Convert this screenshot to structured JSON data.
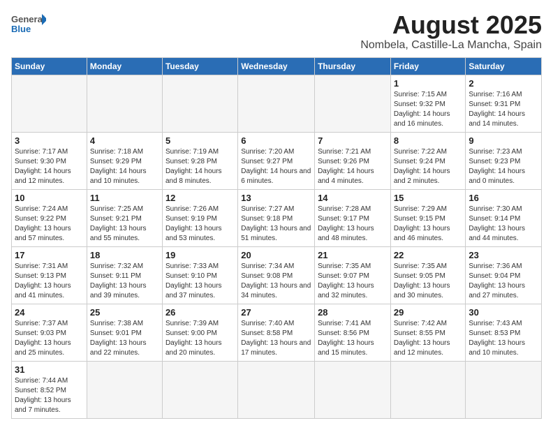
{
  "header": {
    "logo_general": "General",
    "logo_blue": "Blue",
    "month": "August 2025",
    "location": "Nombela, Castille-La Mancha, Spain"
  },
  "weekdays": [
    "Sunday",
    "Monday",
    "Tuesday",
    "Wednesday",
    "Thursday",
    "Friday",
    "Saturday"
  ],
  "weeks": [
    [
      {
        "day": "",
        "info": ""
      },
      {
        "day": "",
        "info": ""
      },
      {
        "day": "",
        "info": ""
      },
      {
        "day": "",
        "info": ""
      },
      {
        "day": "",
        "info": ""
      },
      {
        "day": "1",
        "info": "Sunrise: 7:15 AM\nSunset: 9:32 PM\nDaylight: 14 hours and 16 minutes."
      },
      {
        "day": "2",
        "info": "Sunrise: 7:16 AM\nSunset: 9:31 PM\nDaylight: 14 hours and 14 minutes."
      }
    ],
    [
      {
        "day": "3",
        "info": "Sunrise: 7:17 AM\nSunset: 9:30 PM\nDaylight: 14 hours and 12 minutes."
      },
      {
        "day": "4",
        "info": "Sunrise: 7:18 AM\nSunset: 9:29 PM\nDaylight: 14 hours and 10 minutes."
      },
      {
        "day": "5",
        "info": "Sunrise: 7:19 AM\nSunset: 9:28 PM\nDaylight: 14 hours and 8 minutes."
      },
      {
        "day": "6",
        "info": "Sunrise: 7:20 AM\nSunset: 9:27 PM\nDaylight: 14 hours and 6 minutes."
      },
      {
        "day": "7",
        "info": "Sunrise: 7:21 AM\nSunset: 9:26 PM\nDaylight: 14 hours and 4 minutes."
      },
      {
        "day": "8",
        "info": "Sunrise: 7:22 AM\nSunset: 9:24 PM\nDaylight: 14 hours and 2 minutes."
      },
      {
        "day": "9",
        "info": "Sunrise: 7:23 AM\nSunset: 9:23 PM\nDaylight: 14 hours and 0 minutes."
      }
    ],
    [
      {
        "day": "10",
        "info": "Sunrise: 7:24 AM\nSunset: 9:22 PM\nDaylight: 13 hours and 57 minutes."
      },
      {
        "day": "11",
        "info": "Sunrise: 7:25 AM\nSunset: 9:21 PM\nDaylight: 13 hours and 55 minutes."
      },
      {
        "day": "12",
        "info": "Sunrise: 7:26 AM\nSunset: 9:19 PM\nDaylight: 13 hours and 53 minutes."
      },
      {
        "day": "13",
        "info": "Sunrise: 7:27 AM\nSunset: 9:18 PM\nDaylight: 13 hours and 51 minutes."
      },
      {
        "day": "14",
        "info": "Sunrise: 7:28 AM\nSunset: 9:17 PM\nDaylight: 13 hours and 48 minutes."
      },
      {
        "day": "15",
        "info": "Sunrise: 7:29 AM\nSunset: 9:15 PM\nDaylight: 13 hours and 46 minutes."
      },
      {
        "day": "16",
        "info": "Sunrise: 7:30 AM\nSunset: 9:14 PM\nDaylight: 13 hours and 44 minutes."
      }
    ],
    [
      {
        "day": "17",
        "info": "Sunrise: 7:31 AM\nSunset: 9:13 PM\nDaylight: 13 hours and 41 minutes."
      },
      {
        "day": "18",
        "info": "Sunrise: 7:32 AM\nSunset: 9:11 PM\nDaylight: 13 hours and 39 minutes."
      },
      {
        "day": "19",
        "info": "Sunrise: 7:33 AM\nSunset: 9:10 PM\nDaylight: 13 hours and 37 minutes."
      },
      {
        "day": "20",
        "info": "Sunrise: 7:34 AM\nSunset: 9:08 PM\nDaylight: 13 hours and 34 minutes."
      },
      {
        "day": "21",
        "info": "Sunrise: 7:35 AM\nSunset: 9:07 PM\nDaylight: 13 hours and 32 minutes."
      },
      {
        "day": "22",
        "info": "Sunrise: 7:35 AM\nSunset: 9:05 PM\nDaylight: 13 hours and 30 minutes."
      },
      {
        "day": "23",
        "info": "Sunrise: 7:36 AM\nSunset: 9:04 PM\nDaylight: 13 hours and 27 minutes."
      }
    ],
    [
      {
        "day": "24",
        "info": "Sunrise: 7:37 AM\nSunset: 9:03 PM\nDaylight: 13 hours and 25 minutes."
      },
      {
        "day": "25",
        "info": "Sunrise: 7:38 AM\nSunset: 9:01 PM\nDaylight: 13 hours and 22 minutes."
      },
      {
        "day": "26",
        "info": "Sunrise: 7:39 AM\nSunset: 9:00 PM\nDaylight: 13 hours and 20 minutes."
      },
      {
        "day": "27",
        "info": "Sunrise: 7:40 AM\nSunset: 8:58 PM\nDaylight: 13 hours and 17 minutes."
      },
      {
        "day": "28",
        "info": "Sunrise: 7:41 AM\nSunset: 8:56 PM\nDaylight: 13 hours and 15 minutes."
      },
      {
        "day": "29",
        "info": "Sunrise: 7:42 AM\nSunset: 8:55 PM\nDaylight: 13 hours and 12 minutes."
      },
      {
        "day": "30",
        "info": "Sunrise: 7:43 AM\nSunset: 8:53 PM\nDaylight: 13 hours and 10 minutes."
      }
    ],
    [
      {
        "day": "31",
        "info": "Sunrise: 7:44 AM\nSunset: 8:52 PM\nDaylight: 13 hours and 7 minutes."
      },
      {
        "day": "",
        "info": ""
      },
      {
        "day": "",
        "info": ""
      },
      {
        "day": "",
        "info": ""
      },
      {
        "day": "",
        "info": ""
      },
      {
        "day": "",
        "info": ""
      },
      {
        "day": "",
        "info": ""
      }
    ]
  ]
}
